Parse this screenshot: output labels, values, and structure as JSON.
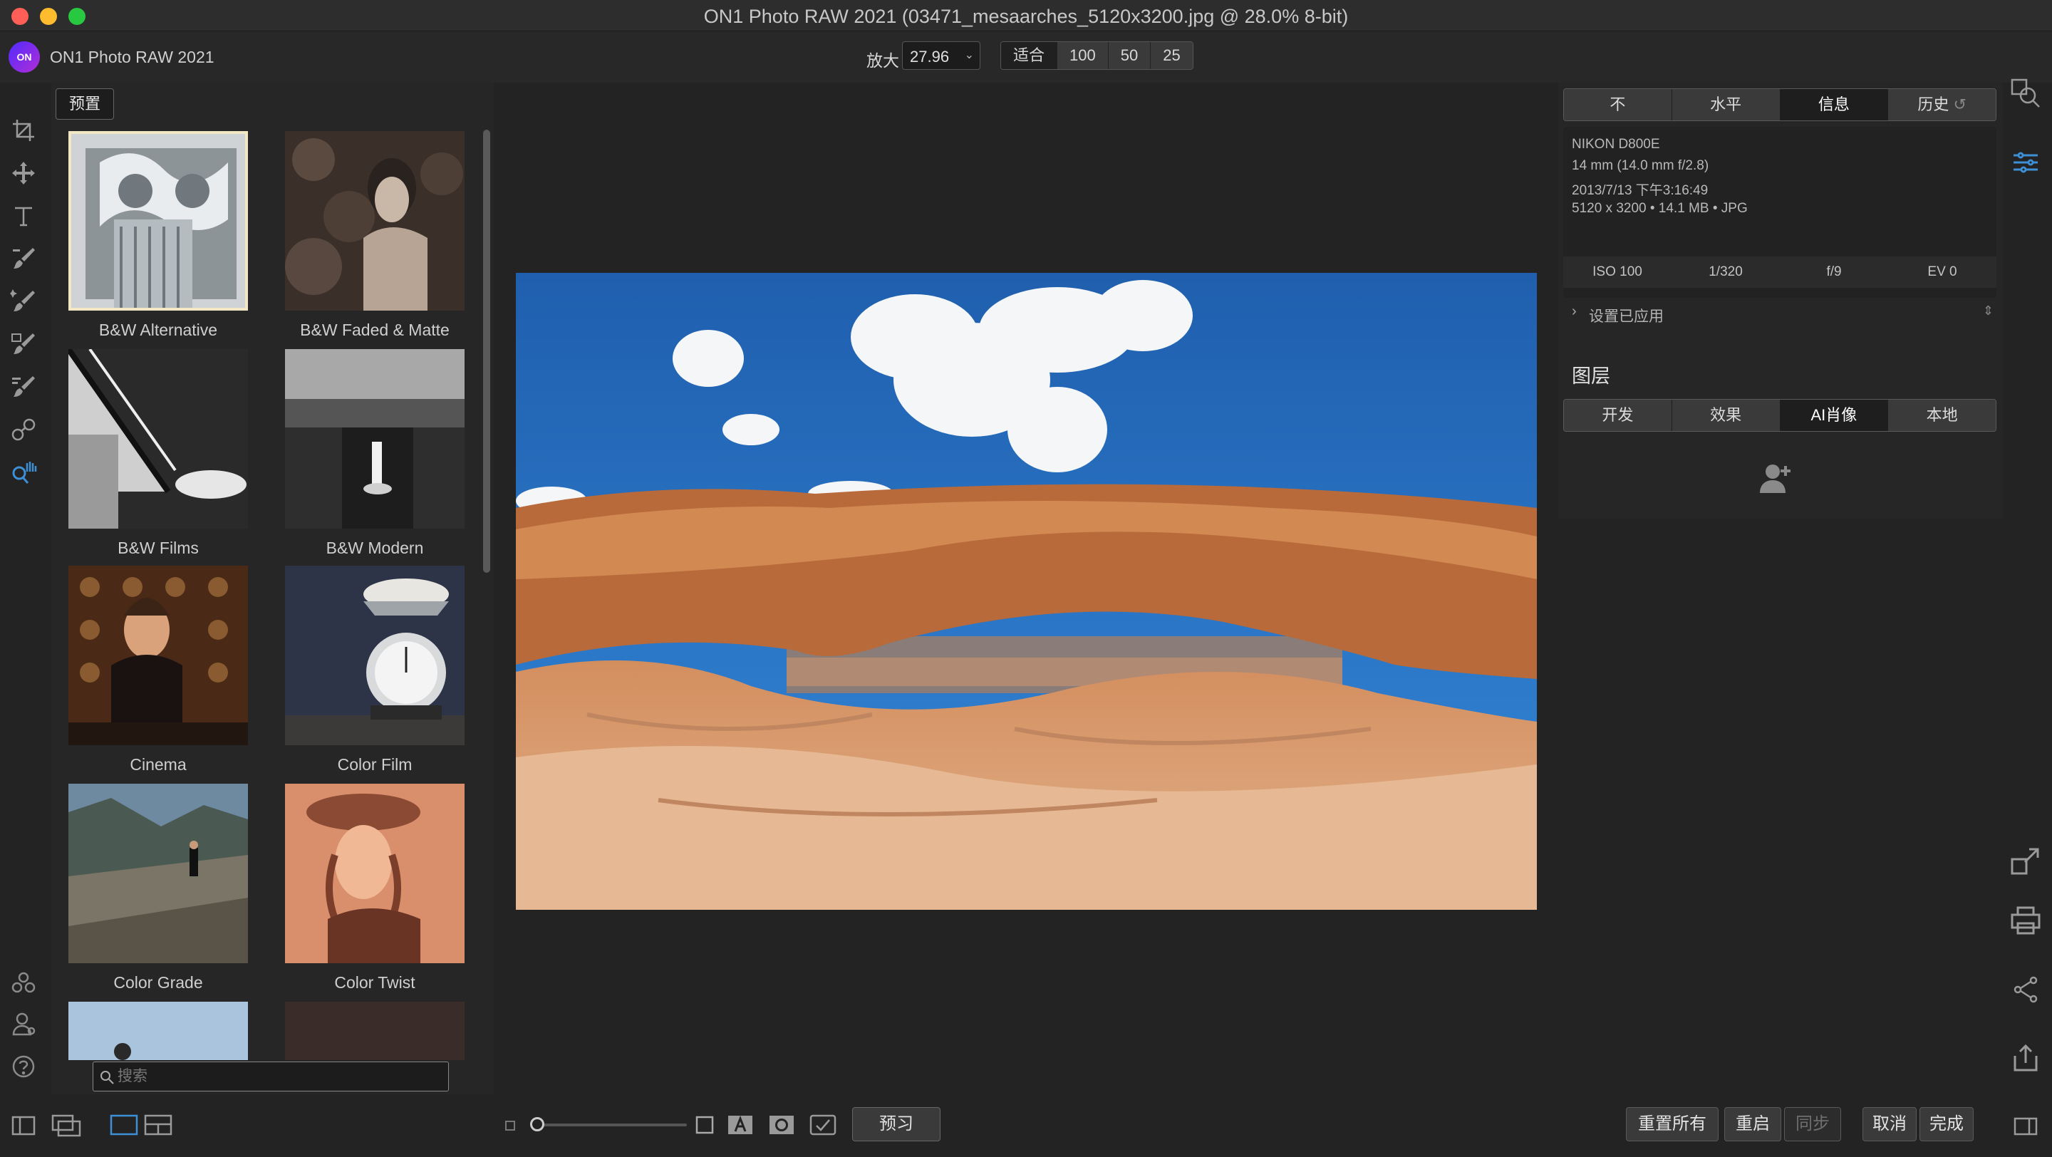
{
  "window": {
    "title": "ON1 Photo RAW 2021 (03471_mesaarches_5120x3200.jpg @ 28.0% 8-bit)"
  },
  "app": {
    "name": "ON1 Photo RAW 2021",
    "logo_text": "ON"
  },
  "zoom": {
    "label": "放大",
    "value": "27.96",
    "presets": [
      "适合",
      "100",
      "50",
      "25"
    ]
  },
  "left_tools": [
    "crop-icon",
    "transform-icon",
    "text-icon",
    "adjustment-brush-icon",
    "retouch-brush-icon",
    "masking-brush-icon",
    "refine-brush-icon",
    "perfect-eraser-icon",
    "view-hand-icon"
  ],
  "presets": {
    "tab_label": "预置",
    "items": [
      {
        "label": "B&W Alternative"
      },
      {
        "label": "B&W Faded & Matte"
      },
      {
        "label": "B&W Films"
      },
      {
        "label": "B&W Modern"
      },
      {
        "label": "Cinema"
      },
      {
        "label": "Color Film"
      },
      {
        "label": "Color Grade"
      },
      {
        "label": "Color Twist"
      }
    ],
    "search_placeholder": "搜索"
  },
  "right_panel": {
    "view_tabs": [
      "不",
      "水平",
      "信息",
      "历史"
    ],
    "active_view_tab": "信息",
    "info": {
      "camera": "NIKON D800E",
      "lens": "14 mm (14.0 mm f/2.8)",
      "datetime": "2013/7/13  下午3:16:49",
      "file": "5120 x 3200 • 14.1 MB • JPG"
    },
    "exif": [
      "ISO 100",
      "1/320",
      "f/9",
      "EV 0"
    ],
    "applied_label": "设置已应用",
    "layers_title": "图层",
    "layer_tabs": [
      "开发",
      "效果",
      "AI肖像",
      "本地"
    ],
    "active_layer_tab": "AI肖像"
  },
  "bottom": {
    "preview_label": "预习",
    "reset_all_label": "重置所有",
    "reset_label": "重启",
    "sync_label": "同步",
    "cancel_label": "取消",
    "done_label": "完成"
  },
  "colors": {
    "accent": "#3d8fd6",
    "panel": "#262626",
    "background": "#232323"
  }
}
